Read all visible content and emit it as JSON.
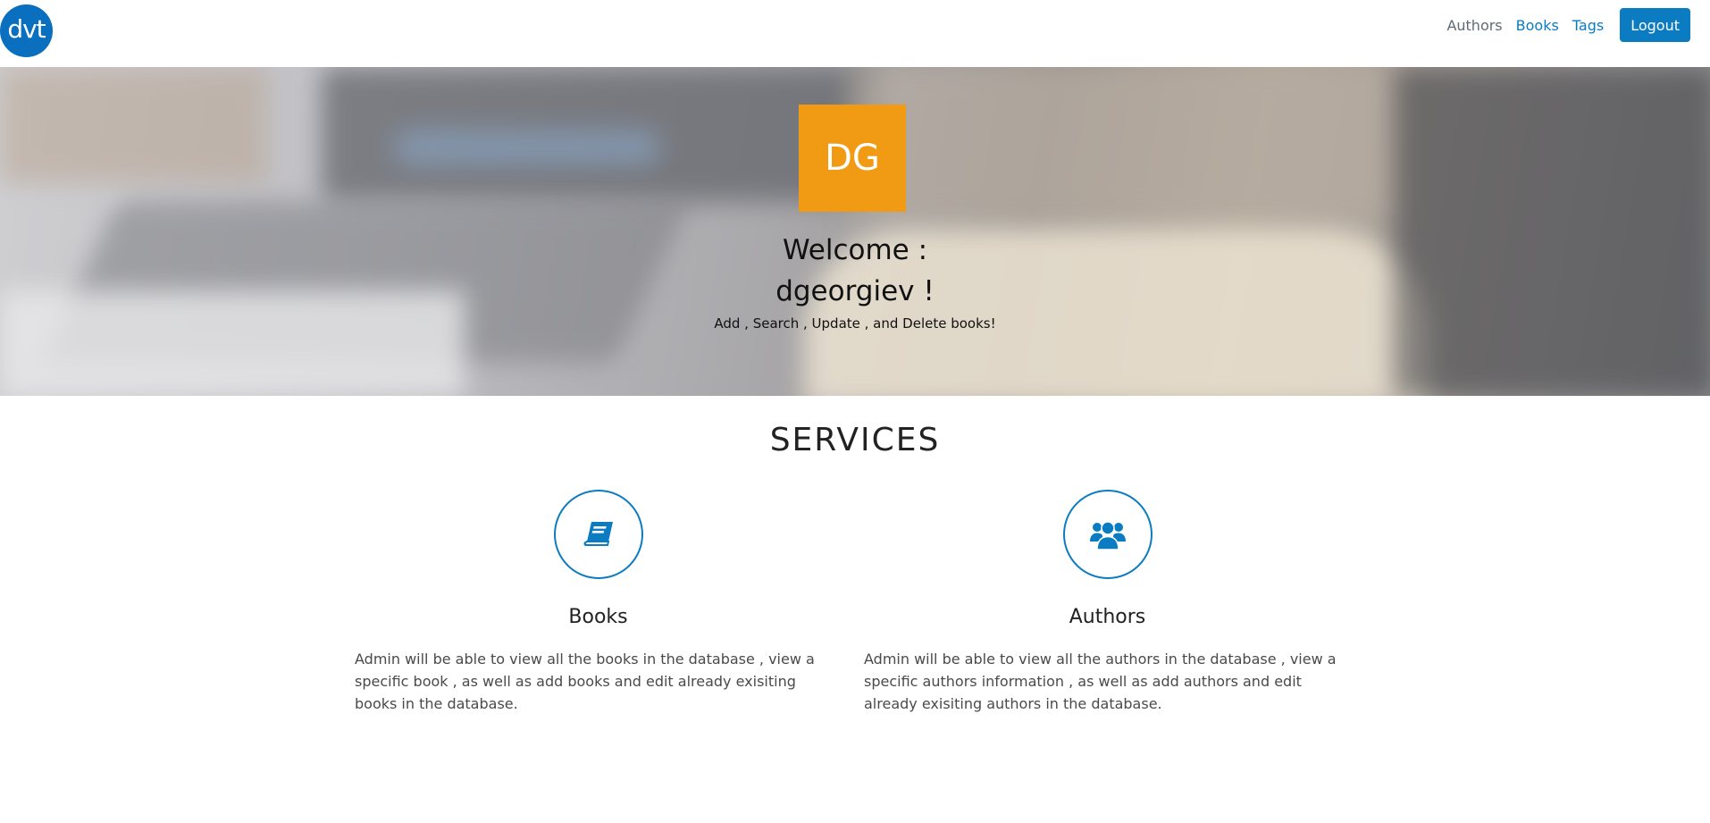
{
  "brand": {
    "logo_text": "dvt",
    "color": "#0a6fbf"
  },
  "nav": {
    "items": [
      {
        "label": "Authors"
      },
      {
        "label": "Books"
      },
      {
        "label": "Tags"
      }
    ],
    "logout_label": "Logout",
    "accent_color": "#0b7cc1"
  },
  "hero": {
    "avatar_initials": "DG",
    "avatar_color": "#f09b13",
    "welcome_line1": "Welcome :",
    "welcome_line2": "dgeorgiev !",
    "subtitle": "Add , Search , Update , and Delete books!"
  },
  "services": {
    "title": "SERVICES",
    "items": [
      {
        "icon": "book-icon",
        "title": "Books",
        "text": "Admin will be able to view all the books in the database , view a specific book , as well as add books and edit already exisiting books in the database."
      },
      {
        "icon": "users-icon",
        "title": "Authors",
        "text": "Admin will be able to view all the authors in the database , view a specific authors information , as well as add authors and edit already exisiting authors in the database."
      }
    ]
  }
}
